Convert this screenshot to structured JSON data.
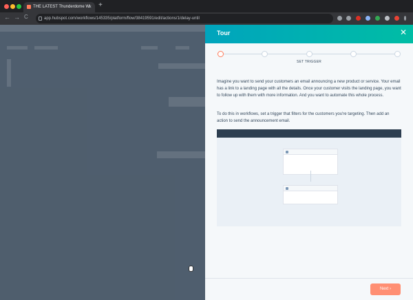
{
  "browser": {
    "tab_title": "THE LATEST Thunderdome Wi",
    "tab_close": "×",
    "new_tab": "+",
    "url": "app.hubspot.com/workflows/145335/platform/flow/38419591/edit/actions/1/delay-until",
    "nav_back": "←",
    "nav_forward": "→",
    "nav_reload": "C",
    "colors": {
      "close": "#ff5f57",
      "minimize": "#febc2e",
      "maximize": "#28c840"
    }
  },
  "tour": {
    "title": "Tour",
    "close_label": "✕",
    "step_label": "SET TRIGGER",
    "paragraph1": "Imagine you want to send your customers an email announcing a new product or service. Your email has a link to a landing page with all the details. Once your customer visits the landing page, you want to follow up with them with more information. And you want to automate this whole process.",
    "paragraph2": "To do this in workflows, set a trigger that filters for the customers you're targeting. Then add an action to send the announcement email.",
    "next_label": "Next  ›",
    "accent_color": "#ff7a59",
    "header_gradient": [
      "#00a4bd",
      "#00bda5"
    ]
  }
}
